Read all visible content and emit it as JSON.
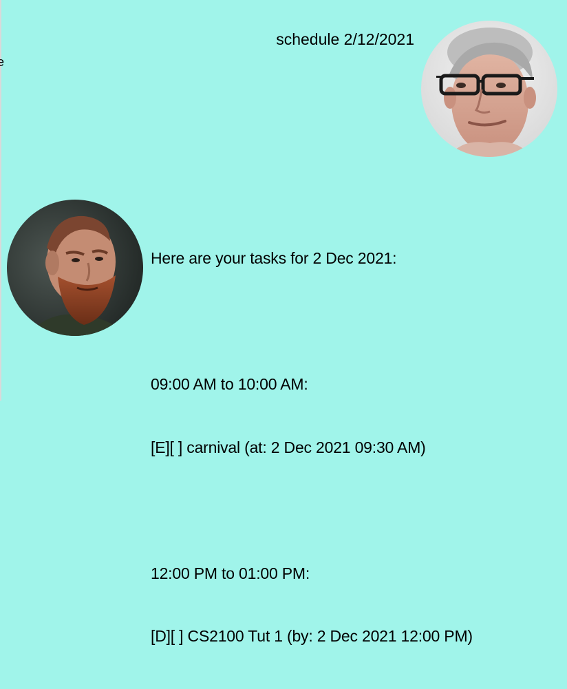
{
  "edge": {
    "glyph": "e"
  },
  "dialogs": {
    "user": {
      "text": "schedule 2/12/2021",
      "avatar_icon": "user-avatar-photo"
    },
    "bot": {
      "lines": [
        "Here are your tasks for 2 Dec 2021:",
        "",
        "09:00 AM to 10:00 AM:",
        "[E][ ] carnival (at: 2 Dec 2021 09:30 AM)",
        "",
        "12:00 PM to 01:00 PM:",
        "[D][ ] CS2100 Tut 1 (by: 2 Dec 2021 12:00 PM)"
      ],
      "avatar_icon": "bot-avatar-photo"
    }
  },
  "colors": {
    "background": "#a0f4ea",
    "text": "#000000"
  }
}
